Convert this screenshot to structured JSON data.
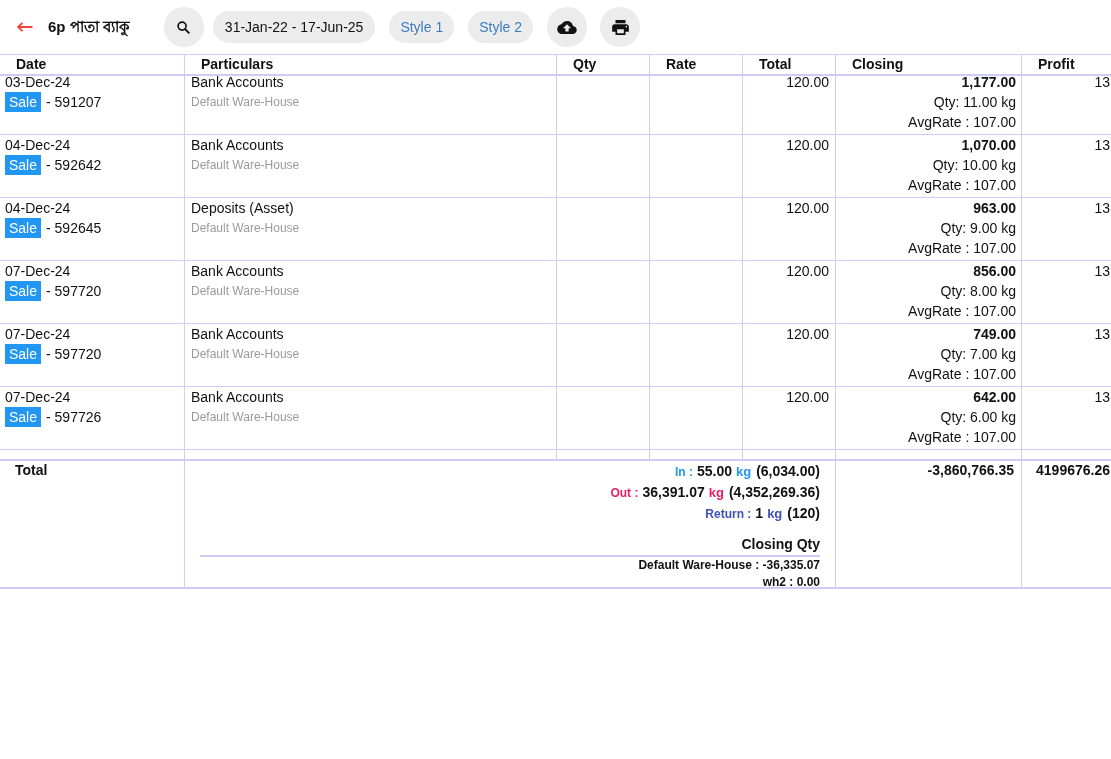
{
  "header": {
    "title": "6p পাতা ব্যাকু",
    "date_range": "31-Jan-22 - 17-Jun-25",
    "style_buttons": [
      "Style 1",
      "Style 2"
    ]
  },
  "table": {
    "columns": [
      "Date",
      "Particulars",
      "Qty",
      "Rate",
      "Total",
      "Closing",
      "Profit"
    ],
    "rows": [
      {
        "date": "03-Dec-24",
        "voucher_type": "Sale",
        "voucher_no": "- 591207",
        "account": "Bank Accounts",
        "warehouse": "Default Ware-House",
        "total": "120.00",
        "closing": "1,177.00",
        "closing_qty": "Qty: 11.00 kg",
        "avg_rate": "AvgRate : 107.00",
        "profit": "13"
      },
      {
        "date": "04-Dec-24",
        "voucher_type": "Sale",
        "voucher_no": "- 592642",
        "account": "Bank Accounts",
        "warehouse": "Default Ware-House",
        "total": "120.00",
        "closing": "1,070.00",
        "closing_qty": "Qty: 10.00 kg",
        "avg_rate": "AvgRate : 107.00",
        "profit": "13"
      },
      {
        "date": "04-Dec-24",
        "voucher_type": "Sale",
        "voucher_no": "- 592645",
        "account": "Deposits (Asset)",
        "warehouse": "Default Ware-House",
        "total": "120.00",
        "closing": "963.00",
        "closing_qty": "Qty: 9.00 kg",
        "avg_rate": "AvgRate : 107.00",
        "profit": "13"
      },
      {
        "date": "07-Dec-24",
        "voucher_type": "Sale",
        "voucher_no": "- 597720",
        "account": "Bank Accounts",
        "warehouse": "Default Ware-House",
        "total": "120.00",
        "closing": "856.00",
        "closing_qty": "Qty: 8.00 kg",
        "avg_rate": "AvgRate : 107.00",
        "profit": "13"
      },
      {
        "date": "07-Dec-24",
        "voucher_type": "Sale",
        "voucher_no": "- 597720",
        "account": "Bank Accounts",
        "warehouse": "Default Ware-House",
        "total": "120.00",
        "closing": "749.00",
        "closing_qty": "Qty: 7.00 kg",
        "avg_rate": "AvgRate : 107.00",
        "profit": "13"
      },
      {
        "date": "07-Dec-24",
        "voucher_type": "Sale",
        "voucher_no": "- 597726",
        "account": "Bank Accounts",
        "warehouse": "Default Ware-House",
        "total": "120.00",
        "closing": "642.00",
        "closing_qty": "Qty: 6.00 kg",
        "avg_rate": "AvgRate : 107.00",
        "profit": "13"
      }
    ],
    "footer": {
      "label": "Total",
      "movements": [
        {
          "label": "In :",
          "qty": "55.00",
          "unit": "kg",
          "amount": "(6,034.00)",
          "color": "#2196f3"
        },
        {
          "label": "Out :",
          "qty": "36,391.07",
          "unit": "kg",
          "amount": "(4,352,269.36)",
          "color": "#e91e63"
        },
        {
          "label": "Return :",
          "qty": "1",
          "unit": "kg",
          "amount": "(120)",
          "color": "#3f51b5"
        }
      ],
      "closing_qty": {
        "title": "Closing Qty",
        "lines": [
          "Default Ware-House : -36,335.07",
          "wh2 : 0.00"
        ]
      },
      "closing": "-3,860,766.35",
      "profit": "4199676.26"
    }
  }
}
